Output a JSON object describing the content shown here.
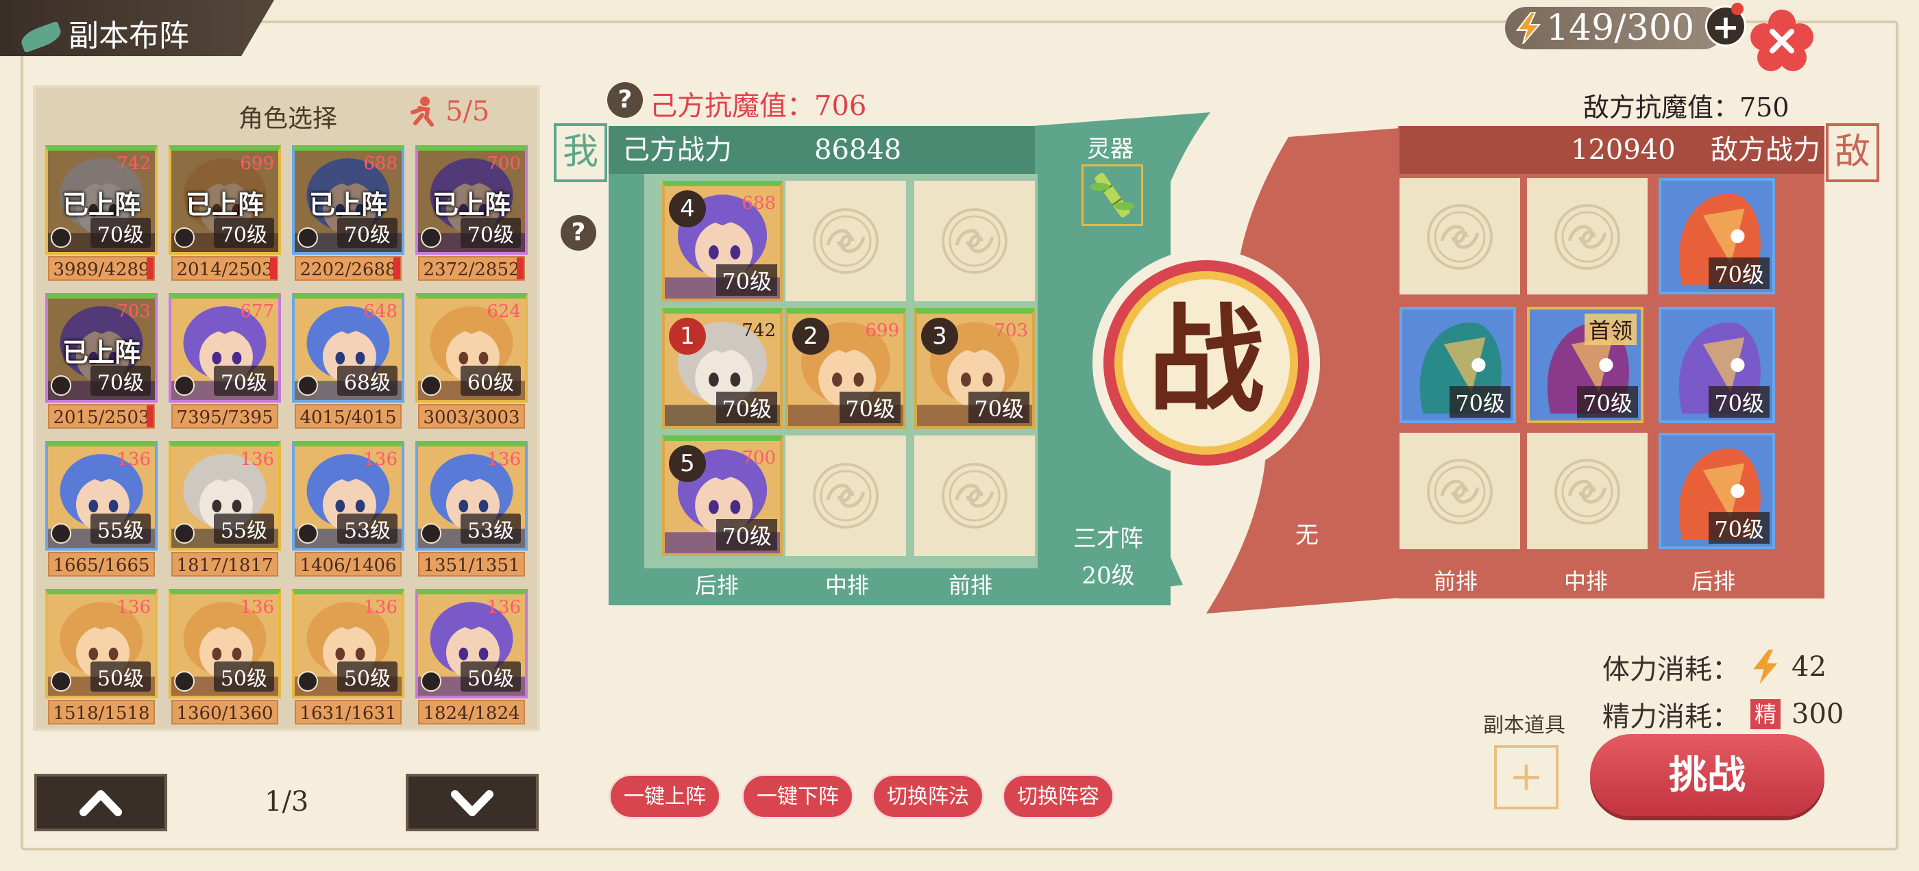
{
  "title": "副本布阵",
  "energy": "149/300",
  "left_panel": {
    "title": "角色选择",
    "count": "5/5",
    "page": "1/3",
    "cards": [
      {
        "power": "742",
        "level": "70级",
        "hp": "3989/4289",
        "deployed": "已上阵",
        "tone": "gray"
      },
      {
        "power": "699",
        "level": "70级",
        "hp": "2014/2503",
        "deployed": "已上阵",
        "tone": "gold"
      },
      {
        "power": "688",
        "level": "70级",
        "hp": "2202/2688",
        "deployed": "已上阵",
        "tone": "blue"
      },
      {
        "power": "700",
        "level": "70级",
        "hp": "2372/2852",
        "deployed": "已上阵",
        "tone": "purple"
      },
      {
        "power": "703",
        "level": "70级",
        "hp": "2015/2503",
        "deployed": "已上阵",
        "tone": "purple"
      },
      {
        "power": "677",
        "level": "70级",
        "hp": "7395/7395",
        "deployed": "",
        "tone": "purple"
      },
      {
        "power": "648",
        "level": "68级",
        "hp": "4015/4015",
        "deployed": "",
        "tone": "blue"
      },
      {
        "power": "624",
        "level": "60级",
        "hp": "3003/3003",
        "deployed": "",
        "tone": "gold"
      },
      {
        "power": "136",
        "level": "55级",
        "hp": "1665/1665",
        "deployed": "",
        "tone": "blue"
      },
      {
        "power": "136",
        "level": "55级",
        "hp": "1817/1817",
        "deployed": "",
        "tone": "gray"
      },
      {
        "power": "136",
        "level": "53级",
        "hp": "1406/1406",
        "deployed": "",
        "tone": "blue"
      },
      {
        "power": "136",
        "level": "53级",
        "hp": "1351/1351",
        "deployed": "",
        "tone": "blue"
      },
      {
        "power": "136",
        "level": "50级",
        "hp": "1518/1518",
        "deployed": "",
        "tone": "gold"
      },
      {
        "power": "136",
        "level": "50级",
        "hp": "1360/1360",
        "deployed": "",
        "tone": "gold"
      },
      {
        "power": "136",
        "level": "50级",
        "hp": "1631/1631",
        "deployed": "",
        "tone": "gold"
      },
      {
        "power": "136",
        "level": "50级",
        "hp": "1824/1824",
        "deployed": "",
        "tone": "purple"
      }
    ]
  },
  "my_side": {
    "resist": "己方抗魔值：706",
    "tag": "我",
    "power_label": "己方战力",
    "power_value": "86848",
    "lingqi": "灵器",
    "formation": "三才阵",
    "formation_level": "20级",
    "rows": [
      "后排",
      "中排",
      "前排"
    ],
    "heroes": [
      {
        "num": "4",
        "level": "70级",
        "power": "688"
      },
      {
        "num": "1",
        "level": "70级",
        "power": "742"
      },
      {
        "num": "2",
        "level": "70级",
        "power": "699"
      },
      {
        "num": "3",
        "level": "70级",
        "power": "703"
      },
      {
        "num": "5",
        "level": "70级",
        "power": "700"
      }
    ]
  },
  "battle_glyph": "战",
  "enemy_side": {
    "resist": "敌方抗魔值：750",
    "tag": "敌",
    "power_label": "敌方战力",
    "power_value": "120940",
    "none": "无",
    "rows": [
      "前排",
      "中排",
      "后排"
    ],
    "heroes": [
      {
        "level": "70级",
        "boss": ""
      },
      {
        "level": "70级",
        "boss": ""
      },
      {
        "level": "70级",
        "boss": "首领"
      },
      {
        "level": "70级",
        "boss": ""
      },
      {
        "level": "70级",
        "boss": ""
      }
    ]
  },
  "buttons": [
    "一键上阵",
    "一键下阵",
    "切换阵法",
    "切换阵容"
  ],
  "cost": {
    "stamina_label": "体力消耗：",
    "stamina_value": "42",
    "energy_label": "精力消耗：",
    "energy_icon": "精",
    "energy_value": "300"
  },
  "item_label": "副本道具",
  "challenge": "挑战",
  "colors": {
    "my_green": "#5fa58c",
    "enemy_red": "#c86556",
    "accent_red": "#d8454e"
  }
}
